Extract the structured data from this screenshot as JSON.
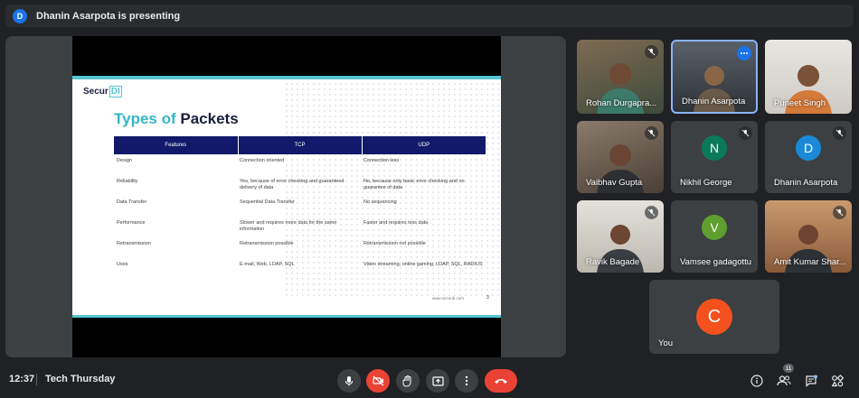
{
  "presenting_bar": {
    "avatar_initial": "D",
    "text": "Dhanin Asarpota is presenting"
  },
  "slide": {
    "logo_text": "Secur",
    "logo_accent": "DI",
    "title_accent": "Types of",
    "title_main": "Packets",
    "columns": [
      "Features",
      "TCP",
      "UDP"
    ],
    "rows": [
      [
        "Design",
        "Connection oriented",
        "Connection less"
      ],
      [
        "Reliability",
        "Yes, because of error checking and guaranteed delivery of data",
        "No, because only basic error checking and no guarantee of data"
      ],
      [
        "Data Transfer",
        "Sequential Data Transfer",
        "No sequencing"
      ],
      [
        "Performance",
        "Slower and requires more data for the same information",
        "Faster and requires less data"
      ],
      [
        "Retransmission",
        "Retransmission possible",
        "Retransmission not possible"
      ],
      [
        "Uses",
        "E-mail, Web, LDAP, SQL",
        "Video streaming, online gaming, LDAP, SQL, RADIUS"
      ]
    ],
    "footer_url": "www.securdi.com",
    "page_number": "3"
  },
  "participants": [
    {
      "name": "Rohan Durgapra...",
      "type": "video",
      "muted": true
    },
    {
      "name": "Dhanin Asarpota",
      "type": "video",
      "muted": false,
      "active": true
    },
    {
      "name": "Puneet Singh",
      "type": "video",
      "muted": false
    },
    {
      "name": "Vaibhav Gupta",
      "type": "video",
      "muted": true
    },
    {
      "name": "Nikhil George",
      "type": "avatar",
      "initial": "N",
      "color": "#0b7a5a",
      "muted": true
    },
    {
      "name": "Dhanin Asarpota",
      "type": "avatar",
      "initial": "D",
      "color": "#1a8ad8",
      "muted": true
    },
    {
      "name": "Ravik Bagade",
      "type": "video",
      "muted": true
    },
    {
      "name": "Vamsee gadagottu",
      "type": "avatar",
      "initial": "V",
      "color": "#5f9e2f",
      "muted": false
    },
    {
      "name": "Amit Kumar Shar...",
      "type": "video",
      "muted": true
    },
    {
      "name": "You",
      "type": "avatar",
      "initial": "C",
      "color": "#f4511e",
      "muted": false
    }
  ],
  "bottom_bar": {
    "time": "12:37",
    "meeting_name": "Tech Thursday",
    "participant_count": "11"
  },
  "colors": {
    "background": "#202124",
    "tile": "#3c4043",
    "end_call": "#ea4335",
    "accent_blue": "#1a73e8",
    "slide_header": "#12196a",
    "slide_teal": "#56c5d0"
  }
}
